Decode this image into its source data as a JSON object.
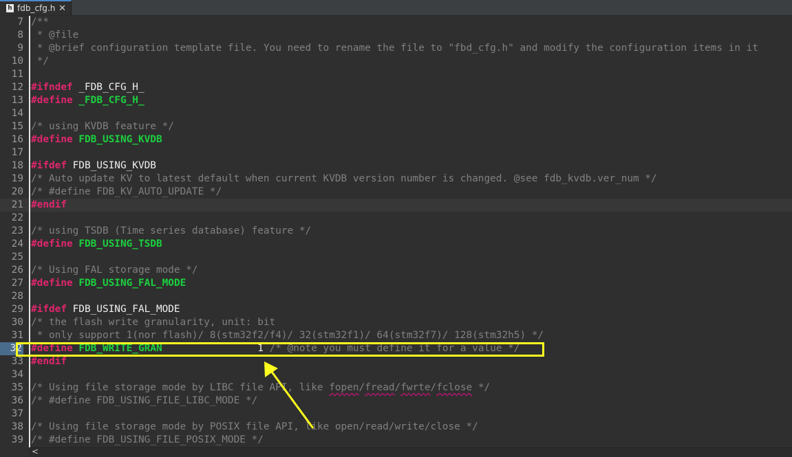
{
  "tab": {
    "icon": "h-file-icon",
    "icon_glyph": "h",
    "label": "fdb_cfg.h",
    "close_glyph": "✕"
  },
  "colors": {
    "comment": "#808080",
    "keyword": "#e0266d",
    "macro": "#1cd03f",
    "identifier": "#f0f0f0",
    "annotation": "#ffff1f"
  },
  "lines": [
    {
      "n": "7",
      "tokens": [
        {
          "t": "/**",
          "c": "cm"
        }
      ]
    },
    {
      "n": "8",
      "tokens": [
        {
          "t": " * @file",
          "c": "cm"
        }
      ]
    },
    {
      "n": "9",
      "tokens": [
        {
          "t": " * @brief configuration template file. You need to rename the file to \"fbd_cfg.h\" and modify the configuration items in it",
          "c": "cm"
        }
      ]
    },
    {
      "n": "10",
      "tokens": [
        {
          "t": " */",
          "c": "cm"
        }
      ]
    },
    {
      "n": "11",
      "tokens": []
    },
    {
      "n": "12",
      "tokens": [
        {
          "t": "#ifndef",
          "c": "kw"
        },
        {
          "t": " _FDB_CFG_H_",
          "c": "id"
        }
      ]
    },
    {
      "n": "13",
      "tokens": [
        {
          "t": "#define",
          "c": "kw"
        },
        {
          "t": " ",
          "c": "id"
        },
        {
          "t": "_FDB_CFG_H_",
          "c": "mac"
        }
      ]
    },
    {
      "n": "14",
      "tokens": []
    },
    {
      "n": "15",
      "tokens": [
        {
          "t": "/* using KVDB feature */",
          "c": "cm"
        }
      ]
    },
    {
      "n": "16",
      "tokens": [
        {
          "t": "#define",
          "c": "kw"
        },
        {
          "t": " ",
          "c": "id"
        },
        {
          "t": "FDB_USING_KVDB",
          "c": "mac"
        }
      ]
    },
    {
      "n": "17",
      "tokens": []
    },
    {
      "n": "18",
      "tokens": [
        {
          "t": "#ifdef",
          "c": "kw"
        },
        {
          "t": " FDB_USING_KVDB",
          "c": "id"
        }
      ]
    },
    {
      "n": "19",
      "tokens": [
        {
          "t": "/* Auto update KV to latest default when current KVDB version number is changed. @see fdb_kvdb.ver_num */",
          "c": "cm"
        }
      ]
    },
    {
      "n": "20",
      "tokens": [
        {
          "t": "/* #define FDB_KV_AUTO_UPDATE */",
          "c": "cm"
        }
      ]
    },
    {
      "n": "21",
      "tokens": [
        {
          "t": "#endif",
          "c": "kw"
        }
      ],
      "current": true
    },
    {
      "n": "22",
      "tokens": []
    },
    {
      "n": "23",
      "tokens": [
        {
          "t": "/* using TSDB (Time series database) feature */",
          "c": "cm"
        }
      ]
    },
    {
      "n": "24",
      "tokens": [
        {
          "t": "#define",
          "c": "kw"
        },
        {
          "t": " ",
          "c": "id"
        },
        {
          "t": "FDB_USING_TSDB",
          "c": "mac"
        }
      ]
    },
    {
      "n": "25",
      "tokens": []
    },
    {
      "n": "26",
      "tokens": [
        {
          "t": "/* Using FAL storage mode */",
          "c": "cm"
        }
      ]
    },
    {
      "n": "27",
      "tokens": [
        {
          "t": "#define",
          "c": "kw"
        },
        {
          "t": " ",
          "c": "id"
        },
        {
          "t": "FDB_USING_FAL_MODE",
          "c": "mac"
        }
      ]
    },
    {
      "n": "28",
      "tokens": []
    },
    {
      "n": "29",
      "tokens": [
        {
          "t": "#ifdef",
          "c": "kw"
        },
        {
          "t": " FDB_USING_FAL_MODE",
          "c": "id"
        }
      ]
    },
    {
      "n": "30",
      "tokens": [
        {
          "t": "/* the flash write granularity, unit: bit",
          "c": "cm"
        }
      ]
    },
    {
      "n": "31",
      "tokens": [
        {
          "t": " * only support 1(nor flash)/ 8(stm32f2/f4)/ 32(stm32f1)/ 64(stm32f7)/ 128(stm32h5) */",
          "c": "cm"
        }
      ]
    },
    {
      "n": "32",
      "tokens": [
        {
          "t": "#define",
          "c": "kw"
        },
        {
          "t": " ",
          "c": "id"
        },
        {
          "t": "FDB_WRITE_GRAN",
          "c": "mac"
        },
        {
          "t": "                ",
          "c": "id"
        },
        {
          "t": "1",
          "c": "num"
        },
        {
          "t": " /* @note you must define it for a value */",
          "c": "cm"
        }
      ],
      "mark": true
    },
    {
      "n": "33",
      "tokens": [
        {
          "t": "#endif",
          "c": "kw"
        }
      ]
    },
    {
      "n": "34",
      "tokens": []
    },
    {
      "n": "35",
      "tokens": [
        {
          "t": "/* Using file storage mode by LIBC file API, like ",
          "c": "cm"
        },
        {
          "t": "fopen",
          "c": "cm sq"
        },
        {
          "t": "/",
          "c": "cm"
        },
        {
          "t": "fread",
          "c": "cm sq"
        },
        {
          "t": "/",
          "c": "cm"
        },
        {
          "t": "fwrte",
          "c": "cm sq"
        },
        {
          "t": "/",
          "c": "cm"
        },
        {
          "t": "fclose",
          "c": "cm sq"
        },
        {
          "t": " */",
          "c": "cm"
        }
      ]
    },
    {
      "n": "36",
      "tokens": [
        {
          "t": "/* #define FDB_USING_FILE_LIBC_MODE */",
          "c": "cm"
        }
      ]
    },
    {
      "n": "37",
      "tokens": []
    },
    {
      "n": "38",
      "tokens": [
        {
          "t": "/* Using file storage mode by POSIX file API, like open/read/write/close */",
          "c": "cm"
        }
      ]
    },
    {
      "n": "39",
      "tokens": [
        {
          "t": "/* #define FDB_USING_FILE_POSIX_MODE */",
          "c": "cm"
        }
      ]
    }
  ],
  "scrollbar": {
    "left_glyph": "<"
  }
}
